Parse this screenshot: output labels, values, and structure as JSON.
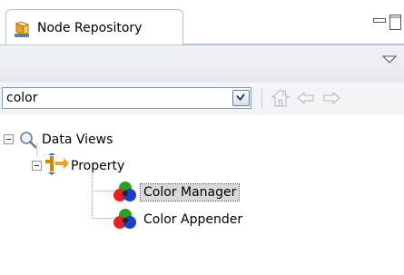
{
  "tab": {
    "title": "Node Repository",
    "icon": "node-repository-icon"
  },
  "view_controls": {
    "minimize_icon": "minimize-icon",
    "maximize_icon": "maximize-icon",
    "menu_icon": "view-menu-chevron-icon"
  },
  "search": {
    "value": "color",
    "dropdown_icon": "chevron-down-icon",
    "nav": {
      "home_icon": "home-icon",
      "back_icon": "arrow-left-icon",
      "forward_icon": "arrow-right-icon"
    }
  },
  "tree": {
    "category": {
      "label": "Data Views",
      "icon": "search-icon",
      "expanded": true
    },
    "subcategory": {
      "label": "Property",
      "icon": "property-icon",
      "expanded": true
    },
    "nodes": [
      {
        "label": "Color Manager",
        "icon": "color-node-icon",
        "selected": true
      },
      {
        "label": "Color Appender",
        "icon": "color-node-icon",
        "selected": false
      }
    ]
  },
  "colors": {
    "border": "#b8c2cc",
    "toolbar_bg": "#eef1f5",
    "property_icon": "#e8a000",
    "selection_bg": "#d9d9d9"
  }
}
